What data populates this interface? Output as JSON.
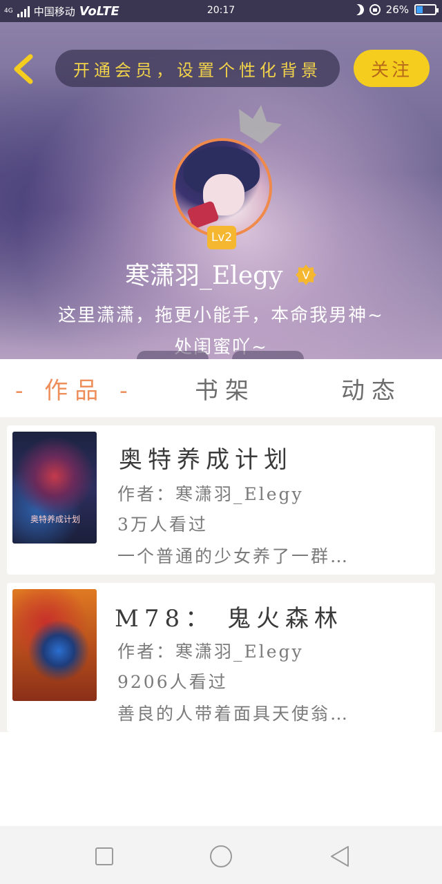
{
  "status_bar": {
    "network": "4G",
    "carrier": "中国移动",
    "volte": "VoLTE",
    "time": "20:17",
    "battery": "26%"
  },
  "header": {
    "banner_text": "开通会员，设置个性化背景",
    "follow_label": "关注",
    "level": "Lv2",
    "username": "寒潇羽_Elegy",
    "bio_line1": "这里潇潇，拖更小能手，本命我男神~",
    "bio_line2": "处闺蜜吖~"
  },
  "tabs": [
    {
      "label": "- 作品 -",
      "active": true
    },
    {
      "label": "书架",
      "active": false
    },
    {
      "label": "动态",
      "active": false
    }
  ],
  "works": [
    {
      "title": "奥特养成计划",
      "author": "作者：寒潇羽_Elegy",
      "views": "3万人看过",
      "desc": "一个普通的少女养了一群…",
      "cover_text": "奥特养成计划"
    },
    {
      "title": "M78： 鬼火森林",
      "author": "作者：寒潇羽_Elegy",
      "views": "9206人看过",
      "desc": "善良的人带着面具天使翁…",
      "cover_text": ""
    }
  ],
  "colors": {
    "accent": "#ee8e5a",
    "follow": "#f5cd1e",
    "banner_text": "#f2d34a"
  }
}
